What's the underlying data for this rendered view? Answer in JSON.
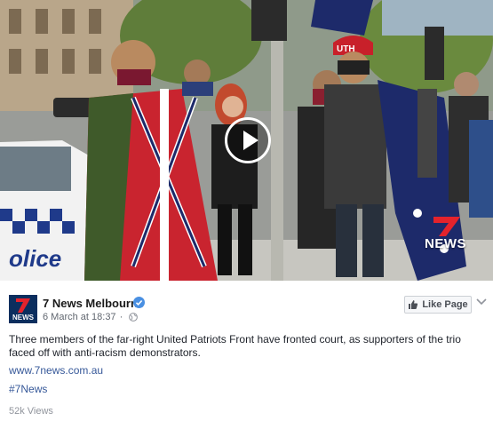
{
  "video": {
    "watermark": "NEWS"
  },
  "post": {
    "page_name": "7 News Melbourne",
    "date": "6 March at 18:37",
    "separator": "·",
    "like_button": "Like Page",
    "text": "Three members of the far-right United Patriots Front have fronted court, as supporters of the trio faced off with anti-racism demonstrators.",
    "link": "www.7news.com.au",
    "hashtag": "#7News",
    "views": "52k Views"
  },
  "brand": {
    "logo_text": "NEWS",
    "accent_red": "#e4232c",
    "logo_bg": "#0b2e5e",
    "link_color": "#365899"
  },
  "scene": {
    "police_car_text": "olice",
    "cap_text": "UTH"
  }
}
